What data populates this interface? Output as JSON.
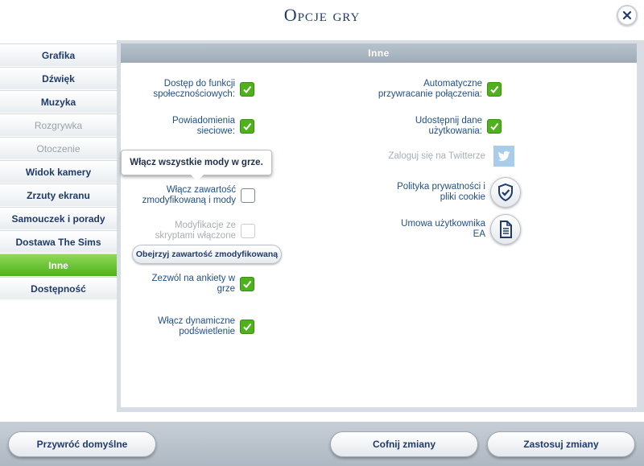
{
  "window": {
    "title": "Opcje gry"
  },
  "icons": {
    "close": "close-icon",
    "check": "checkmark-icon",
    "twitter": "twitter-bird-icon",
    "privacy": "shield-check-icon",
    "agreement": "document-icon"
  },
  "colors": {
    "accent_green": "#4fb11c",
    "title_blue": "#1f3b6a",
    "label_blue": "#1f4f8a",
    "header_gray": "#a8b4bf"
  },
  "sidebar": {
    "items": [
      {
        "label": "Grafika",
        "state": "normal"
      },
      {
        "label": "Dźwięk",
        "state": "normal"
      },
      {
        "label": "Muzyka",
        "state": "normal"
      },
      {
        "label": "Rozgrywka",
        "state": "disabled"
      },
      {
        "label": "Otoczenie",
        "state": "disabled"
      },
      {
        "label": "Widok kamery",
        "state": "normal"
      },
      {
        "label": "Zrzuty ekranu",
        "state": "normal"
      },
      {
        "label": "Samouczek i porady",
        "state": "normal"
      },
      {
        "label": "Dostawa The Sims",
        "state": "normal"
      },
      {
        "label": "Inne",
        "state": "active"
      },
      {
        "label": "Dostępność",
        "state": "normal"
      }
    ]
  },
  "panel": {
    "header": "Inne",
    "left_options": {
      "social": {
        "label_1": "Dostęp do funkcji",
        "label_2": "społecznościowych:",
        "checked": true
      },
      "notifications": {
        "label_1": "Powiadomienia",
        "label_2": "sieciowe:",
        "checked": true
      },
      "custom_content": {
        "label_1": "Włącz zawartość",
        "label_2": "zmodyfikowaną i mody",
        "checked": false
      },
      "script_mods": {
        "label_1": "Modyfikacje ze",
        "label_2": "skryptami włączone",
        "checked": false,
        "disabled": true
      },
      "surveys": {
        "label_1": "Zezwól na ankiety w",
        "label_2": "grze",
        "checked": true
      },
      "lighting": {
        "label_1": "Włącz dynamiczne",
        "label_2": "podświetlenie",
        "checked": true
      }
    },
    "view_custom_content_button": "Obejrzyj zawartość zmodyfikowaną",
    "tooltip": "Włącz wszystkie mody w grze.",
    "right_options": {
      "auto_reconnect": {
        "label_1": "Automatyczne",
        "label_2": "przywracanie połączenia:",
        "checked": true
      },
      "share_usage": {
        "label_1": "Udostępnij dane",
        "label_2": "użytkowania:",
        "checked": true
      },
      "twitter": {
        "label": "Zaloguj się na Twitterze"
      },
      "privacy": {
        "label_1": "Polityka prywatności i",
        "label_2": "pliki cookie"
      },
      "user_agreement": {
        "label_1": "Umowa użytkownika",
        "label_2": "EA"
      }
    }
  },
  "footer": {
    "restore_defaults": "Przywróć domyślne",
    "undo_changes": "Cofnij zmiany",
    "apply_changes": "Zastosuj zmiany"
  }
}
